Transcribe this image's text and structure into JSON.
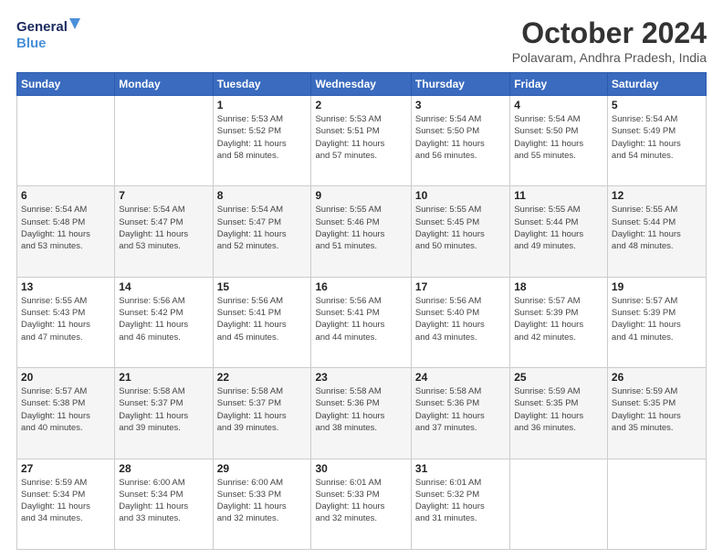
{
  "logo": {
    "line1": "General",
    "line2": "Blue"
  },
  "title": "October 2024",
  "location": "Polavaram, Andhra Pradesh, India",
  "header_days": [
    "Sunday",
    "Monday",
    "Tuesday",
    "Wednesday",
    "Thursday",
    "Friday",
    "Saturday"
  ],
  "weeks": [
    [
      {
        "day": "",
        "info": ""
      },
      {
        "day": "",
        "info": ""
      },
      {
        "day": "1",
        "info": "Sunrise: 5:53 AM\nSunset: 5:52 PM\nDaylight: 11 hours\nand 58 minutes."
      },
      {
        "day": "2",
        "info": "Sunrise: 5:53 AM\nSunset: 5:51 PM\nDaylight: 11 hours\nand 57 minutes."
      },
      {
        "day": "3",
        "info": "Sunrise: 5:54 AM\nSunset: 5:50 PM\nDaylight: 11 hours\nand 56 minutes."
      },
      {
        "day": "4",
        "info": "Sunrise: 5:54 AM\nSunset: 5:50 PM\nDaylight: 11 hours\nand 55 minutes."
      },
      {
        "day": "5",
        "info": "Sunrise: 5:54 AM\nSunset: 5:49 PM\nDaylight: 11 hours\nand 54 minutes."
      }
    ],
    [
      {
        "day": "6",
        "info": "Sunrise: 5:54 AM\nSunset: 5:48 PM\nDaylight: 11 hours\nand 53 minutes."
      },
      {
        "day": "7",
        "info": "Sunrise: 5:54 AM\nSunset: 5:47 PM\nDaylight: 11 hours\nand 53 minutes."
      },
      {
        "day": "8",
        "info": "Sunrise: 5:54 AM\nSunset: 5:47 PM\nDaylight: 11 hours\nand 52 minutes."
      },
      {
        "day": "9",
        "info": "Sunrise: 5:55 AM\nSunset: 5:46 PM\nDaylight: 11 hours\nand 51 minutes."
      },
      {
        "day": "10",
        "info": "Sunrise: 5:55 AM\nSunset: 5:45 PM\nDaylight: 11 hours\nand 50 minutes."
      },
      {
        "day": "11",
        "info": "Sunrise: 5:55 AM\nSunset: 5:44 PM\nDaylight: 11 hours\nand 49 minutes."
      },
      {
        "day": "12",
        "info": "Sunrise: 5:55 AM\nSunset: 5:44 PM\nDaylight: 11 hours\nand 48 minutes."
      }
    ],
    [
      {
        "day": "13",
        "info": "Sunrise: 5:55 AM\nSunset: 5:43 PM\nDaylight: 11 hours\nand 47 minutes."
      },
      {
        "day": "14",
        "info": "Sunrise: 5:56 AM\nSunset: 5:42 PM\nDaylight: 11 hours\nand 46 minutes."
      },
      {
        "day": "15",
        "info": "Sunrise: 5:56 AM\nSunset: 5:41 PM\nDaylight: 11 hours\nand 45 minutes."
      },
      {
        "day": "16",
        "info": "Sunrise: 5:56 AM\nSunset: 5:41 PM\nDaylight: 11 hours\nand 44 minutes."
      },
      {
        "day": "17",
        "info": "Sunrise: 5:56 AM\nSunset: 5:40 PM\nDaylight: 11 hours\nand 43 minutes."
      },
      {
        "day": "18",
        "info": "Sunrise: 5:57 AM\nSunset: 5:39 PM\nDaylight: 11 hours\nand 42 minutes."
      },
      {
        "day": "19",
        "info": "Sunrise: 5:57 AM\nSunset: 5:39 PM\nDaylight: 11 hours\nand 41 minutes."
      }
    ],
    [
      {
        "day": "20",
        "info": "Sunrise: 5:57 AM\nSunset: 5:38 PM\nDaylight: 11 hours\nand 40 minutes."
      },
      {
        "day": "21",
        "info": "Sunrise: 5:58 AM\nSunset: 5:37 PM\nDaylight: 11 hours\nand 39 minutes."
      },
      {
        "day": "22",
        "info": "Sunrise: 5:58 AM\nSunset: 5:37 PM\nDaylight: 11 hours\nand 39 minutes."
      },
      {
        "day": "23",
        "info": "Sunrise: 5:58 AM\nSunset: 5:36 PM\nDaylight: 11 hours\nand 38 minutes."
      },
      {
        "day": "24",
        "info": "Sunrise: 5:58 AM\nSunset: 5:36 PM\nDaylight: 11 hours\nand 37 minutes."
      },
      {
        "day": "25",
        "info": "Sunrise: 5:59 AM\nSunset: 5:35 PM\nDaylight: 11 hours\nand 36 minutes."
      },
      {
        "day": "26",
        "info": "Sunrise: 5:59 AM\nSunset: 5:35 PM\nDaylight: 11 hours\nand 35 minutes."
      }
    ],
    [
      {
        "day": "27",
        "info": "Sunrise: 5:59 AM\nSunset: 5:34 PM\nDaylight: 11 hours\nand 34 minutes."
      },
      {
        "day": "28",
        "info": "Sunrise: 6:00 AM\nSunset: 5:34 PM\nDaylight: 11 hours\nand 33 minutes."
      },
      {
        "day": "29",
        "info": "Sunrise: 6:00 AM\nSunset: 5:33 PM\nDaylight: 11 hours\nand 32 minutes."
      },
      {
        "day": "30",
        "info": "Sunrise: 6:01 AM\nSunset: 5:33 PM\nDaylight: 11 hours\nand 32 minutes."
      },
      {
        "day": "31",
        "info": "Sunrise: 6:01 AM\nSunset: 5:32 PM\nDaylight: 11 hours\nand 31 minutes."
      },
      {
        "day": "",
        "info": ""
      },
      {
        "day": "",
        "info": ""
      }
    ]
  ]
}
